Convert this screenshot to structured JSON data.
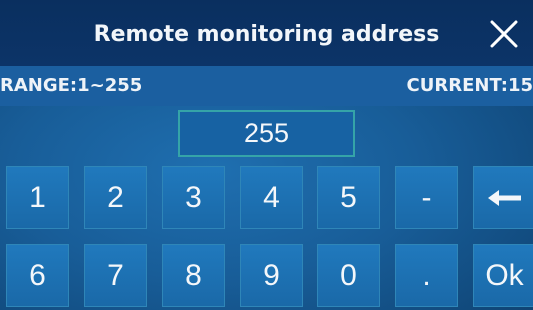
{
  "dialog": {
    "title": "Remote monitoring address",
    "close_icon": "close-icon"
  },
  "info": {
    "range": "RANGE:1~255",
    "current": "CURRENT:15"
  },
  "input": {
    "value": "255"
  },
  "keypad": {
    "rows": [
      [
        "1",
        "2",
        "3",
        "4",
        "5",
        "-",
        "←"
      ],
      [
        "6",
        "7",
        "8",
        "9",
        "0",
        ".",
        "Ok"
      ]
    ],
    "backspace_icon": "left-arrow-icon"
  },
  "colors": {
    "titlebar": "#0c3468",
    "panel": "#1b5fa0",
    "key_border": "#2f86b8",
    "display_border": "#35a4a8",
    "text": "#f4f7fa"
  }
}
